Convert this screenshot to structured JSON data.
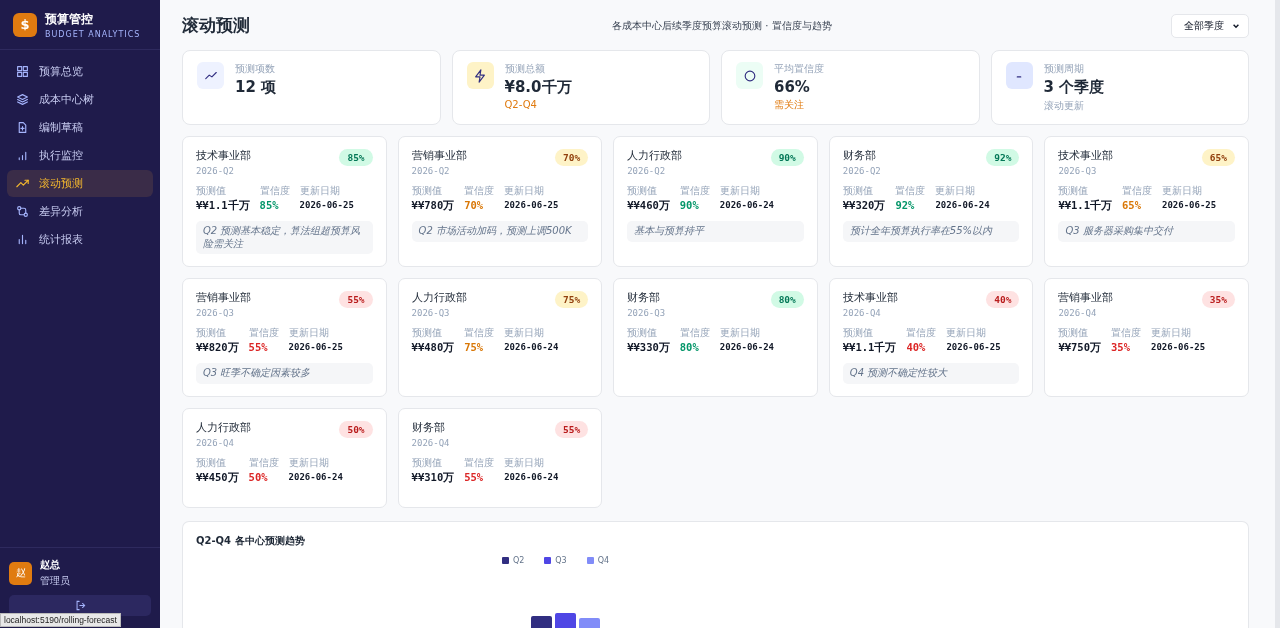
{
  "brand": {
    "logo": "$",
    "title": "预算管控",
    "subtitle": "BUDGET ANALYTICS"
  },
  "nav": [
    {
      "label": "预算总览",
      "selected": false
    },
    {
      "label": "成本中心树",
      "selected": false
    },
    {
      "label": "编制草稿",
      "selected": false
    },
    {
      "label": "执行监控",
      "selected": false
    },
    {
      "label": "滚动预测",
      "selected": true
    },
    {
      "label": "差异分析",
      "selected": false
    },
    {
      "label": "统计报表",
      "selected": false
    }
  ],
  "user": {
    "avatar": "赵",
    "name": "赵总",
    "role": "管理员"
  },
  "status_url": "localhost:5190/rolling-forecast",
  "header": {
    "title": "滚动预测",
    "subtitle": "各成本中心后续季度预算滚动预测 · 置信度与趋势",
    "filter": "全部季度"
  },
  "stats": [
    {
      "label": "预测项数",
      "value": "12 项"
    },
    {
      "label": "预测总额",
      "value": "¥8.0千万",
      "sub": {
        "text": "Q2-Q4",
        "kind": "warning"
      }
    },
    {
      "label": "平均置信度",
      "value": "66%",
      "sub": {
        "text": "需关注",
        "kind": "warning"
      }
    },
    {
      "label": "预测周期",
      "value": "3 个季度",
      "sub": {
        "text": "滚动更新",
        "kind": "muted"
      }
    }
  ],
  "forecasts": [
    {
      "center": "技术事业部",
      "period": "2026-Q2",
      "badge": "85%",
      "kind": "high",
      "value_label": "预测值",
      "value": "¥¥1.1千万",
      "confidence_label": "置信度",
      "confidence": "85%",
      "updated_label": "更新日期",
      "updated": "2026-06-25",
      "note": "Q2 预测基本稳定，算法组超预算风险需关注"
    },
    {
      "center": "营销事业部",
      "period": "2026-Q2",
      "badge": "70%",
      "kind": "medium",
      "value_label": "预测值",
      "value": "¥¥780万",
      "confidence_label": "置信度",
      "confidence": "70%",
      "updated_label": "更新日期",
      "updated": "2026-06-25",
      "note": "Q2 市场活动加码，预测上调500K"
    },
    {
      "center": "人力行政部",
      "period": "2026-Q2",
      "badge": "90%",
      "kind": "high",
      "value_label": "预测值",
      "value": "¥¥460万",
      "confidence_label": "置信度",
      "confidence": "90%",
      "updated_label": "更新日期",
      "updated": "2026-06-24",
      "note": "基本与预算持平"
    },
    {
      "center": "财务部",
      "period": "2026-Q2",
      "badge": "92%",
      "kind": "high",
      "value_label": "预测值",
      "value": "¥¥320万",
      "confidence_label": "置信度",
      "confidence": "92%",
      "updated_label": "更新日期",
      "updated": "2026-06-24",
      "note": "预计全年预算执行率在55%以内"
    },
    {
      "center": "技术事业部",
      "period": "2026-Q3",
      "badge": "65%",
      "kind": "medium",
      "value_label": "预测值",
      "value": "¥¥1.1千万",
      "confidence_label": "置信度",
      "confidence": "65%",
      "updated_label": "更新日期",
      "updated": "2026-06-25",
      "note": "Q3 服务器采购集中交付"
    },
    {
      "center": "营销事业部",
      "period": "2026-Q3",
      "badge": "55%",
      "kind": "low",
      "value_label": "预测值",
      "value": "¥¥820万",
      "confidence_label": "置信度",
      "confidence": "55%",
      "updated_label": "更新日期",
      "updated": "2026-06-25",
      "note": "Q3 旺季不确定因素较多"
    },
    {
      "center": "人力行政部",
      "period": "2026-Q3",
      "badge": "75%",
      "kind": "medium",
      "value_label": "预测值",
      "value": "¥¥480万",
      "confidence_label": "置信度",
      "confidence": "75%",
      "updated_label": "更新日期",
      "updated": "2026-06-24"
    },
    {
      "center": "财务部",
      "period": "2026-Q3",
      "badge": "80%",
      "kind": "high",
      "value_label": "预测值",
      "value": "¥¥330万",
      "confidence_label": "置信度",
      "confidence": "80%",
      "updated_label": "更新日期",
      "updated": "2026-06-24"
    },
    {
      "center": "技术事业部",
      "period": "2026-Q4",
      "badge": "40%",
      "kind": "low",
      "value_label": "预测值",
      "value": "¥¥1.1千万",
      "confidence_label": "置信度",
      "confidence": "40%",
      "updated_label": "更新日期",
      "updated": "2026-06-25",
      "note": "Q4 预测不确定性较大"
    },
    {
      "center": "营销事业部",
      "period": "2026-Q4",
      "badge": "35%",
      "kind": "low",
      "value_label": "预测值",
      "value": "¥¥750万",
      "confidence_label": "置信度",
      "confidence": "35%",
      "updated_label": "更新日期",
      "updated": "2026-06-25"
    },
    {
      "center": "人力行政部",
      "period": "2026-Q4",
      "badge": "50%",
      "kind": "low",
      "value_label": "预测值",
      "value": "¥¥450万",
      "confidence_label": "置信度",
      "confidence": "50%",
      "updated_label": "更新日期",
      "updated": "2026-06-24"
    },
    {
      "center": "财务部",
      "period": "2026-Q4",
      "badge": "55%",
      "kind": "low",
      "value_label": "预测值",
      "value": "¥¥310万",
      "confidence_label": "置信度",
      "confidence": "55%",
      "updated_label": "更新日期",
      "updated": "2026-06-24"
    }
  ],
  "chart": {
    "title": "Q2-Q4 各中心预测趋势",
    "legend": [
      {
        "label": "Q2",
        "color": "#312e81"
      },
      {
        "label": "Q3",
        "color": "#4f46e5"
      },
      {
        "label": "Q4",
        "color": "#818cf8"
      }
    ]
  }
}
